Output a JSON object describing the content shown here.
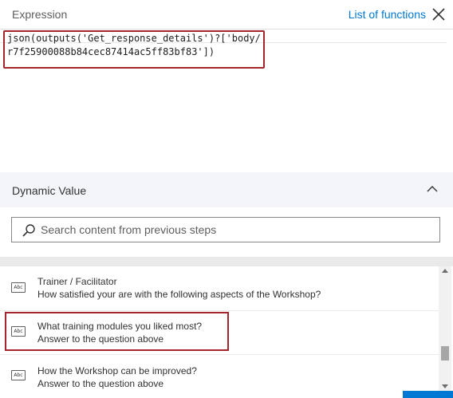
{
  "header": {
    "title": "Expression",
    "link_label": "List of functions",
    "close_icon": "close-icon"
  },
  "editor": {
    "line1": "json(outputs('Get_response_details')?['body/",
    "line2": "r7f25900088b84cec87414ac5ff83bf83'])"
  },
  "dynamic": {
    "title": "Dynamic Value",
    "collapse_icon": "chevron-up-icon"
  },
  "search": {
    "placeholder": "Search content from previous steps",
    "icon": "search-icon"
  },
  "list": {
    "items": [
      {
        "icon": "Abc",
        "title": "Trainer / Facilitator",
        "subtitle": "How satisfied your are with the following aspects of the Workshop?"
      },
      {
        "icon": "Abc",
        "title": "What training modules you liked most?",
        "subtitle": "Answer to the question above"
      },
      {
        "icon": "Abc",
        "title": "How the Workshop can be improved?",
        "subtitle": "Answer to the question above"
      }
    ]
  },
  "colors": {
    "accent": "#0078d4",
    "highlight_border": "#a4262c",
    "section_bg": "#f3f5fb"
  }
}
